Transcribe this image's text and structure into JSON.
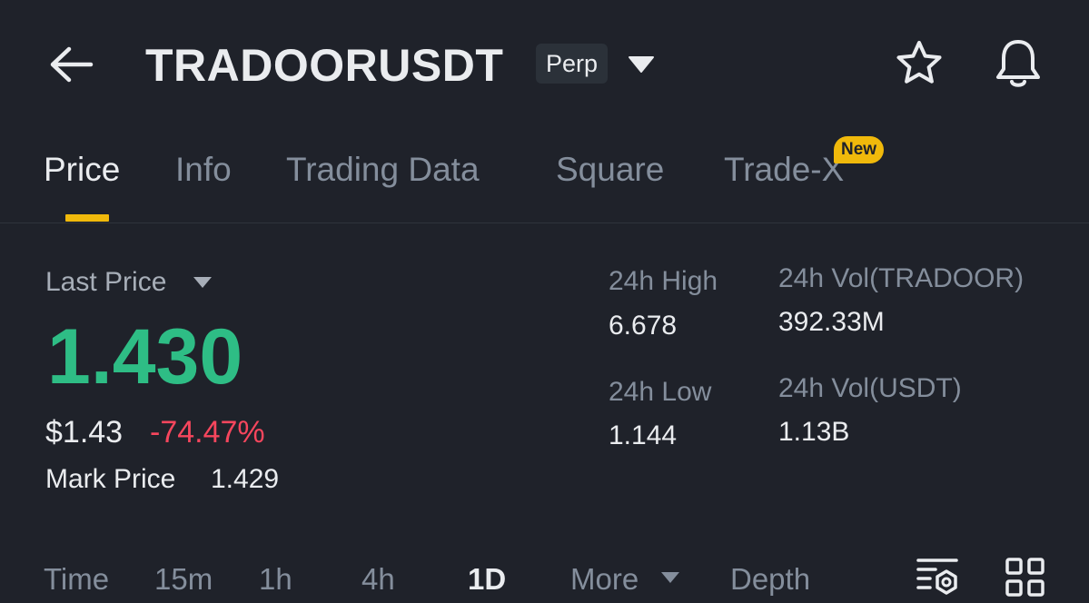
{
  "header": {
    "symbol": "TRADOORUSDT",
    "contract_type": "Perp",
    "icons": {
      "back": "arrow-left-icon",
      "dropdown": "caret-down-icon",
      "favorite": "star-icon",
      "alerts": "bell-icon"
    }
  },
  "tabs": [
    {
      "label": "Price",
      "active": true
    },
    {
      "label": "Info",
      "active": false
    },
    {
      "label": "Trading Data",
      "active": false
    },
    {
      "label": "Square",
      "active": false
    },
    {
      "label": "Trade-X",
      "active": false,
      "badge": "New"
    }
  ],
  "price": {
    "label": "Last Price",
    "last": "1.430",
    "usd": "$1.43",
    "change_pct": "-74.47%",
    "mark_label": "Mark Price",
    "mark_value": "1.429"
  },
  "stats": {
    "high_label": "24h High",
    "high_value": "6.678",
    "low_label": "24h Low",
    "low_value": "1.144",
    "vol_base_label": "24h Vol(TRADOOR)",
    "vol_base_value": "392.33M",
    "vol_quote_label": "24h Vol(USDT)",
    "vol_quote_value": "1.13B"
  },
  "intervals": [
    {
      "label": "Time",
      "active": false
    },
    {
      "label": "15m",
      "active": false
    },
    {
      "label": "1h",
      "active": false
    },
    {
      "label": "4h",
      "active": false
    },
    {
      "label": "1D",
      "active": true
    },
    {
      "label": "More",
      "active": false
    },
    {
      "label": "Depth",
      "active": false
    }
  ],
  "toolbar_icons": {
    "indicators": "indicator-settings-icon",
    "layout": "grid-layout-icon"
  },
  "colors": {
    "background": "#1f222a",
    "up": "#2ebd85",
    "down": "#f6465d",
    "accent": "#f0b90b",
    "text_primary": "#eaecef",
    "text_secondary": "#848e9c",
    "badge_bg": "#2b3139"
  }
}
